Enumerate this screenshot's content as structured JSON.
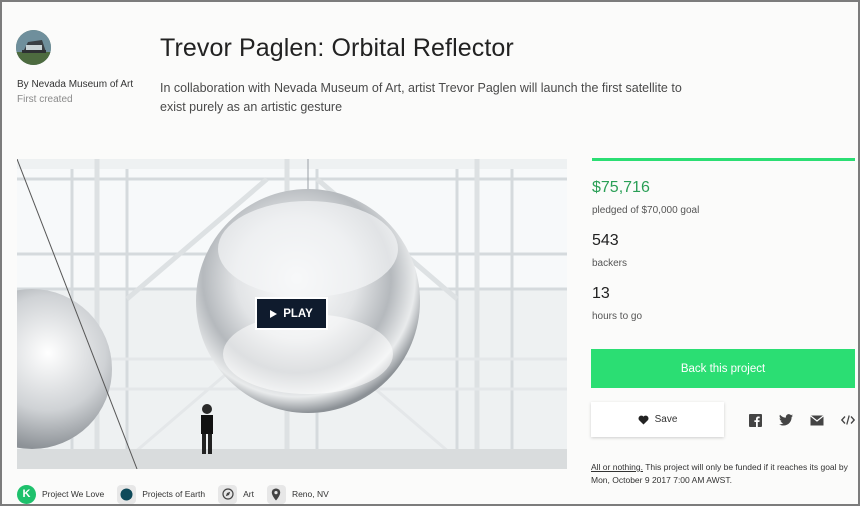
{
  "creator": {
    "by_line": "By Nevada Museum of Art",
    "first_created": "First created"
  },
  "project": {
    "title": "Trevor Paglen: Orbital Reflector",
    "blurb": "In collaboration with Nevada Museum of Art, artist Trevor Paglen will launch the first satellite to exist purely as an artistic gesture"
  },
  "video": {
    "play_label": "PLAY"
  },
  "stats": {
    "funding_progress": 1.0,
    "pledged_amount": "$75,716",
    "pledged_sub": "pledged of $70,000 goal",
    "backers_count": "543",
    "backers_label": "backers",
    "time_count": "13",
    "time_label": "hours to go"
  },
  "actions": {
    "back_label": "Back this project",
    "save_label": "Save",
    "share_icons": [
      "facebook-icon",
      "twitter-icon",
      "email-icon",
      "embed-icon"
    ]
  },
  "funding_note": {
    "all_or_nothing": "All or nothing.",
    "text": " This project will only be funded if it reaches its goal by Mon, October 9 2017 7:00 AM AWST."
  },
  "tags": [
    {
      "label": "Project We Love",
      "icon": "kickstarter-k-icon"
    },
    {
      "label": "Projects of Earth",
      "icon": "earth-icon"
    },
    {
      "label": "Art",
      "icon": "compass-icon"
    },
    {
      "label": "Reno, NV",
      "icon": "location-pin-icon"
    }
  ],
  "colors": {
    "accent_green": "#2bde73",
    "pledged_green": "#2a9f56",
    "play_bg": "#0f1b2d"
  }
}
